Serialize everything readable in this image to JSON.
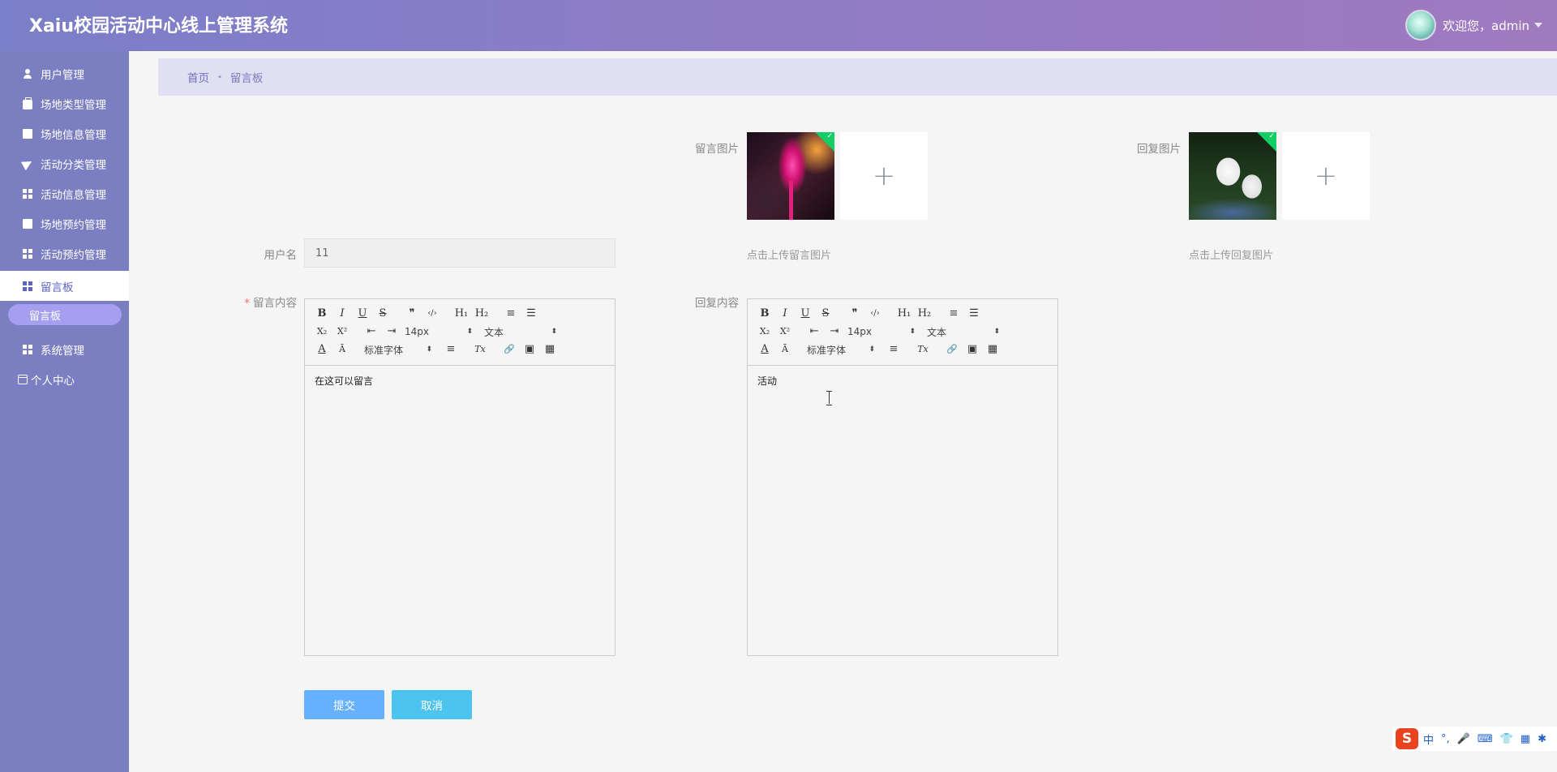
{
  "header": {
    "title": "Xaiu校园活动中心线上管理系统",
    "welcome": "欢迎您，admin"
  },
  "sidebar": {
    "items": [
      {
        "label": "用户管理",
        "icon": "user-icon"
      },
      {
        "label": "场地类型管理",
        "icon": "briefcase-icon"
      },
      {
        "label": "场地信息管理",
        "icon": "monitor-icon"
      },
      {
        "label": "活动分类管理",
        "icon": "paper-plane-icon"
      },
      {
        "label": "活动信息管理",
        "icon": "grid-icon"
      },
      {
        "label": "场地预约管理",
        "icon": "monitor-icon"
      },
      {
        "label": "活动预约管理",
        "icon": "grid-icon"
      },
      {
        "label": "留言板",
        "icon": "grid-icon",
        "active": true
      },
      {
        "label": "系统管理",
        "icon": "grid-icon"
      },
      {
        "label": "个人中心",
        "icon": "calendar-icon"
      }
    ],
    "sub_item": "留言板"
  },
  "breadcrumb": {
    "home": "首页",
    "separator": "•",
    "current": "留言板"
  },
  "form": {
    "message_image_label": "留言图片",
    "reply_image_label": "回复图片",
    "message_image_hint": "点击上传留言图片",
    "reply_image_hint": "点击上传回复图片",
    "upload_plus": "+",
    "username_label": "用户名",
    "username_value": "11",
    "message_content_label": "留言内容",
    "reply_content_label": "回复内容",
    "required_mark": "*",
    "message_content": "在这可以留言",
    "reply_content": "活动",
    "submit_label": "提交",
    "cancel_label": "取消"
  },
  "editor_toolbar": {
    "font_size": "14px",
    "header_select": "文本",
    "font_family": "标准字体",
    "bold": "B",
    "italic": "I",
    "underline": "U",
    "strike": "S",
    "blockquote": "❞",
    "code": "‹/›",
    "h1": "H₁",
    "h2": "H₂",
    "ordered_list": "≡",
    "bullet_list": "☰",
    "sub": "X₂",
    "sup": "X²",
    "outdent": "⇤",
    "indent": "⇥",
    "color": "A",
    "background": "Ā",
    "align": "≡",
    "clean": "Tx",
    "link": "🔗",
    "image": "▣",
    "video": "▦",
    "select_arrow": "⬍"
  },
  "ime_bar": {
    "logo": "S",
    "lang": "中",
    "punct": "°,",
    "mic": "🎤",
    "keyboard": "⌨",
    "skin": "👕",
    "grid": "▦",
    "settings": "✱"
  },
  "colors": {
    "header_start": "#7b7ec8",
    "sidebar": "#7b7fc2",
    "submit": "#66b1ff",
    "cancel": "#4dc3ef",
    "upload_ok": "#13ce66"
  }
}
